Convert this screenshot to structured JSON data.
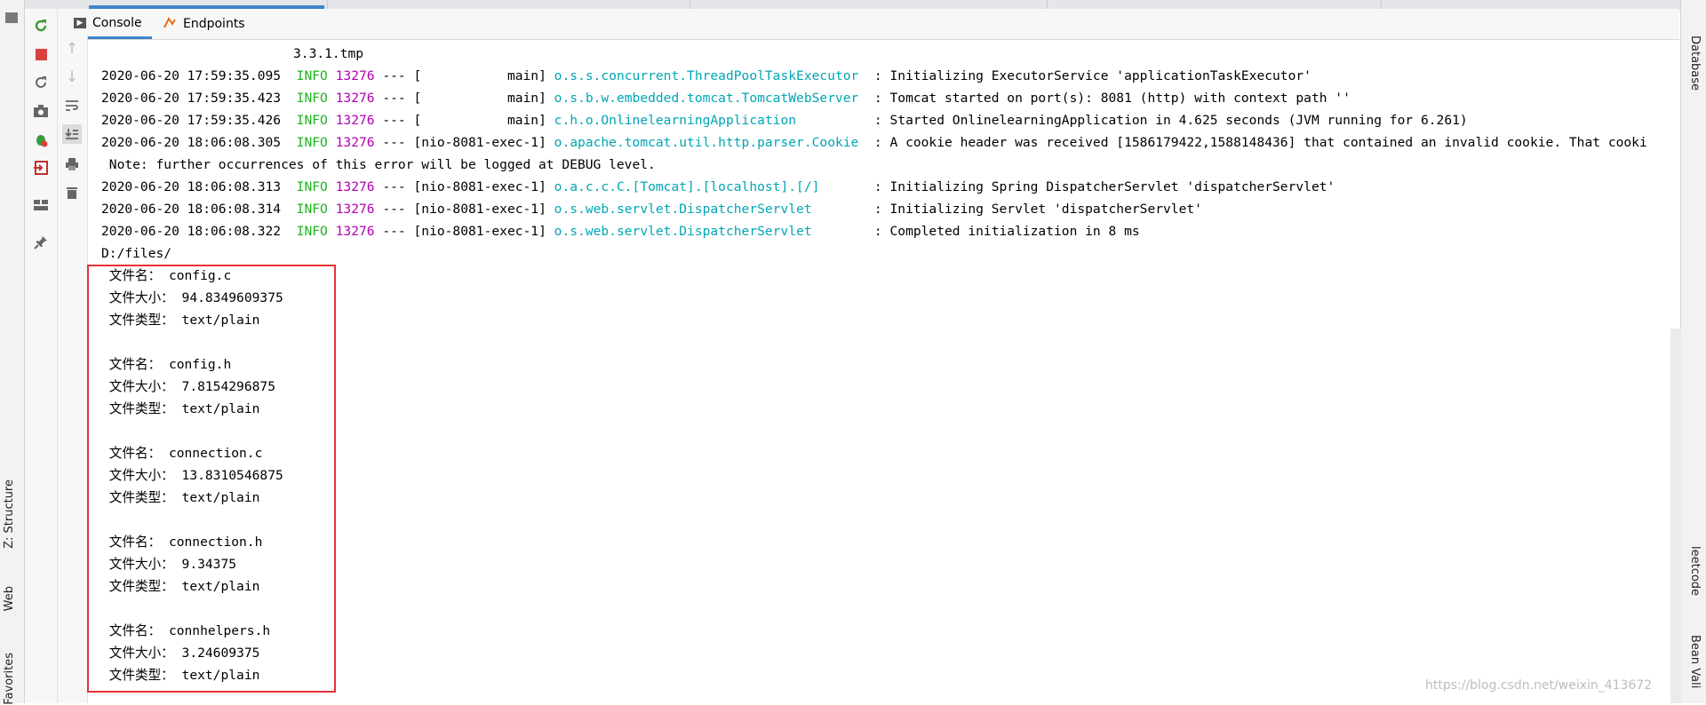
{
  "left_strip": {
    "labels": [
      "Z: Structure",
      "Web",
      "Favorites"
    ]
  },
  "right_strip": {
    "labels": [
      "Database",
      "leetcode",
      "Bean Vali"
    ]
  },
  "tabs": [
    {
      "label": "Console",
      "icon": "console-icon"
    },
    {
      "label": "Endpoints",
      "icon": "endpoints-icon"
    }
  ],
  "console": {
    "first_line": "3.3.1.tmp",
    "log_lines": [
      {
        "ts": "2020-06-20 17:59:35.095",
        "level": "INFO",
        "pid": "13276",
        "thread": "--- [           main]",
        "cls": "o.s.s.concurrent.ThreadPoolTaskExecutor",
        "msg": ": Initializing ExecutorService 'applicationTaskExecutor'"
      },
      {
        "ts": "2020-06-20 17:59:35.423",
        "level": "INFO",
        "pid": "13276",
        "thread": "--- [           main]",
        "cls": "o.s.b.w.embedded.tomcat.TomcatWebServer",
        "msg": ": Tomcat started on port(s): 8081 (http) with context path ''"
      },
      {
        "ts": "2020-06-20 17:59:35.426",
        "level": "INFO",
        "pid": "13276",
        "thread": "--- [           main]",
        "cls": "c.h.o.OnlinelearningApplication",
        "msg": ": Started OnlinelearningApplication in 4.625 seconds (JVM running for 6.261)"
      },
      {
        "ts": "2020-06-20 18:06:08.305",
        "level": "INFO",
        "pid": "13276",
        "thread": "--- [nio-8081-exec-1]",
        "cls": "o.apache.tomcat.util.http.parser.Cookie",
        "msg": ": A cookie header was received [1586179422,1588148436] that contained an invalid cookie. That cooki"
      }
    ],
    "note_line": " Note: further occurrences of this error will be logged at DEBUG level.",
    "log_lines2": [
      {
        "ts": "2020-06-20 18:06:08.313",
        "level": "INFO",
        "pid": "13276",
        "thread": "--- [nio-8081-exec-1]",
        "cls": "o.a.c.c.C.[Tomcat].[localhost].[/]",
        "msg": ": Initializing Spring DispatcherServlet 'dispatcherServlet'"
      },
      {
        "ts": "2020-06-20 18:06:08.314",
        "level": "INFO",
        "pid": "13276",
        "thread": "--- [nio-8081-exec-1]",
        "cls": "o.s.web.servlet.DispatcherServlet",
        "msg": ": Initializing Servlet 'dispatcherServlet'"
      },
      {
        "ts": "2020-06-20 18:06:08.322",
        "level": "INFO",
        "pid": "13276",
        "thread": "--- [nio-8081-exec-1]",
        "cls": "o.s.web.servlet.DispatcherServlet",
        "msg": ": Completed initialization in 8 ms"
      }
    ],
    "dir_line": "D:/files/",
    "files": [
      {
        "name_label": " 文件名： config.c",
        "size_label": " 文件大小： 94.8349609375",
        "type_label": " 文件类型： text/plain"
      },
      {
        "name_label": " 文件名： config.h",
        "size_label": " 文件大小： 7.8154296875",
        "type_label": " 文件类型： text/plain"
      },
      {
        "name_label": " 文件名： connection.c",
        "size_label": " 文件大小： 13.8310546875",
        "type_label": " 文件类型： text/plain"
      },
      {
        "name_label": " 文件名： connection.h",
        "size_label": " 文件大小： 9.34375",
        "type_label": " 文件类型： text/plain"
      },
      {
        "name_label": " 文件名： connhelpers.h",
        "size_label": " 文件大小： 3.24609375",
        "type_label": " 文件类型： text/plain"
      }
    ]
  },
  "watermark": "https://blog.csdn.net/weixin_413672",
  "colors": {
    "info": "#1fb31f",
    "pid": "#b000b0",
    "logger": "#00a6b4",
    "highlight_box": "#e53333",
    "tab_accent": "#4083c9"
  }
}
